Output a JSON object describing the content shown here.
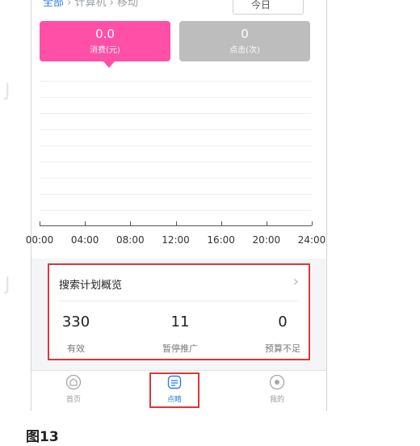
{
  "breadcrumb": {
    "active": "全部",
    "rest": " › 计算机 › 移动",
    "right_label": "今日"
  },
  "metrics": [
    {
      "value": "0.0",
      "label": "消费(元)",
      "color": "#ff4fa7"
    },
    {
      "value": "0",
      "label": "点击(次)",
      "color": "#bdbdbd"
    }
  ],
  "chart_data": {
    "type": "line",
    "x": [
      "00:00",
      "04:00",
      "08:00",
      "12:00",
      "16:00",
      "20:00",
      "24:00"
    ],
    "series": [],
    "grid": true
  },
  "overview": {
    "title": "搜索计划概览",
    "stats": [
      {
        "value": "330",
        "label": "有效"
      },
      {
        "value": "11",
        "label": "暂停推广"
      },
      {
        "value": "0",
        "label": "预算不足"
      }
    ]
  },
  "tabbar": {
    "home": "首页",
    "plan": "点睛",
    "mine": "我的"
  },
  "watermark": "J",
  "caption": "图13"
}
